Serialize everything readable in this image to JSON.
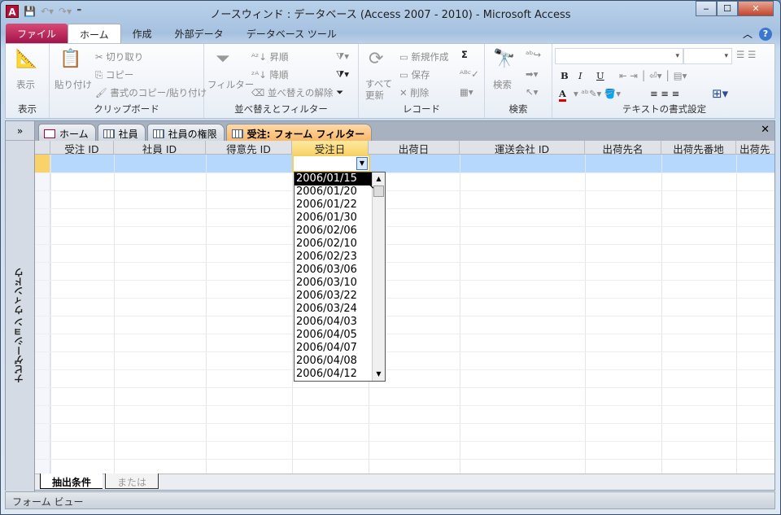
{
  "window": {
    "title": "ノースウィンド : データベース (Access 2007 - 2010)  -  Microsoft Access",
    "app_icon": "A",
    "minimize": "‒",
    "maximize": "☐",
    "close": "✕"
  },
  "ribbon_tabs": [
    "ファイル",
    "ホーム",
    "作成",
    "外部データ",
    "データベース ツール"
  ],
  "ribbon": {
    "view": {
      "button": "表示",
      "group": "表示"
    },
    "clipboard": {
      "paste": "貼り付け",
      "cut": "切り取り",
      "copy": "コピー",
      "format_painter": "書式のコピー/貼り付け",
      "group": "クリップボード"
    },
    "sort_filter": {
      "filter": "フィルター",
      "ascending": "昇順",
      "descending": "降順",
      "clear_sort": "並べ替えの解除",
      "group": "並べ替えとフィルター"
    },
    "records": {
      "refresh_all": "すべて\n更新",
      "new": "新規作成",
      "save": "保存",
      "delete": "削除",
      "sum": "Σ",
      "group": "レコード"
    },
    "find": {
      "find": "検索",
      "group": "検索"
    },
    "text_format": {
      "bold": "B",
      "italic": "I",
      "underline": "U",
      "group": "テキストの書式設定",
      "font_color": "#e00000"
    }
  },
  "nav_pane": {
    "label": "ナビゲーション ウィンドウ",
    "expand": "»"
  },
  "doc_tabs": [
    "ホーム",
    "社員",
    "社員の権限",
    "受注: フォーム フィルター"
  ],
  "grid": {
    "columns": [
      "受注 ID",
      "社員 ID",
      "得意先 ID",
      "受注日",
      "出荷日",
      "運送会社 ID",
      "出荷先名",
      "出荷先番地",
      "出荷先"
    ],
    "selected_column": "受注日"
  },
  "dropdown": {
    "items": [
      "2006/01/15",
      "2006/01/20",
      "2006/01/22",
      "2006/01/30",
      "2006/02/06",
      "2006/02/10",
      "2006/02/23",
      "2006/03/06",
      "2006/03/10",
      "2006/03/22",
      "2006/03/24",
      "2006/04/03",
      "2006/04/05",
      "2006/04/07",
      "2006/04/08",
      "2006/04/12"
    ],
    "highlighted": "2006/01/15"
  },
  "bottom_tabs": [
    "抽出条件",
    "または"
  ],
  "status": "フォーム ビュー"
}
